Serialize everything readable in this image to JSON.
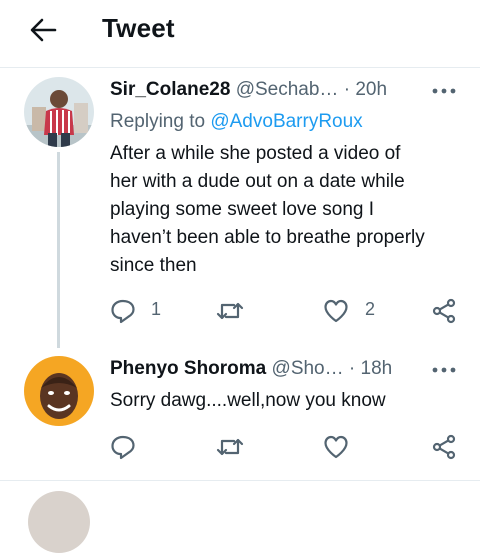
{
  "header": {
    "title": "Tweet"
  },
  "tweets": [
    {
      "username": "Sir_Colane28",
      "handle": "@Sechab…",
      "dot": "·",
      "time": "20h",
      "reply_prefix": "Replying to",
      "reply_to": "@AdvoBarryRoux",
      "lines": [
        "After a while she posted a video of",
        "her with a dude out on a date while",
        "playing some sweet love song I",
        "haven’t been able to breathe properly",
        "since then"
      ],
      "reply_count": "1",
      "retweet_count": "",
      "like_count": "2"
    },
    {
      "username": "Phenyo Shoroma",
      "handle": "@Sho…",
      "dot": "·",
      "time": "18h",
      "lines": [
        "Sorry dawg....well,now you know"
      ],
      "reply_count": "",
      "retweet_count": "",
      "like_count": ""
    }
  ],
  "colors": {
    "accent": "#1d9bf0",
    "secondary_text": "#536471",
    "icon": "#536471",
    "divider": "#e6ecf0",
    "thread_line": "#cfd9de"
  },
  "icons": [
    "back-arrow-icon",
    "more-icon",
    "reply-icon",
    "retweet-icon",
    "like-icon",
    "share-icon"
  ]
}
